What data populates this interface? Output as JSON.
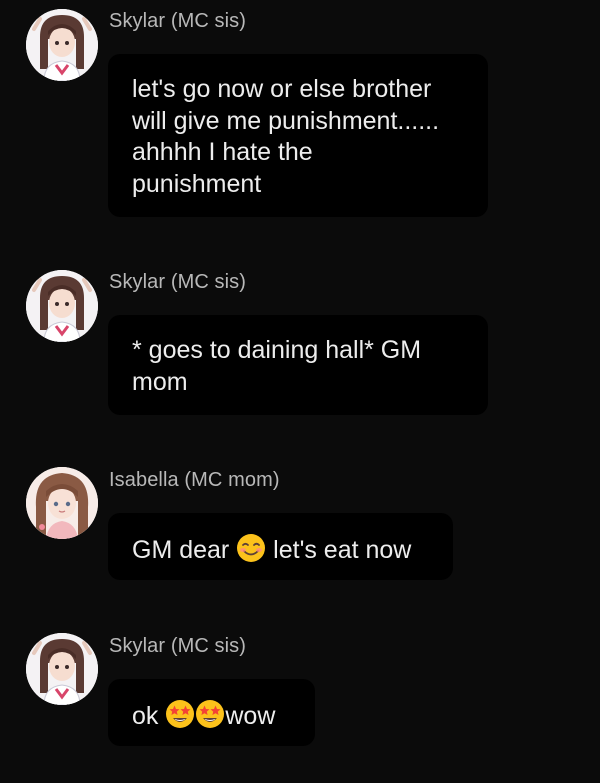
{
  "messages": [
    {
      "sender": "Skylar (MC sis)",
      "avatar": "skylar-avatar",
      "lines": [
        "let's go now or else brother",
        "will give me punishment......",
        "ahhhh I hate the",
        "punishment"
      ]
    },
    {
      "sender": "Skylar (MC sis)",
      "avatar": "skylar-avatar",
      "lines": [
        "* goes to daining hall* GM",
        "mom"
      ]
    },
    {
      "sender": "Isabella (MC mom)",
      "avatar": "isabella-avatar",
      "text_before": "GM dear",
      "emoji": "smiling-face-emoji",
      "text_after": "let's eat now"
    },
    {
      "sender": "Skylar (MC sis)",
      "avatar": "skylar-avatar",
      "text_before": "ok",
      "emojis": [
        "star-struck-emoji",
        "star-struck-emoji"
      ],
      "text_after": "wow"
    }
  ],
  "colors": {
    "background": "#0b0b0b",
    "bubble": "#000000",
    "sender_text": "#b8b8b8",
    "message_text": "#ededed"
  }
}
